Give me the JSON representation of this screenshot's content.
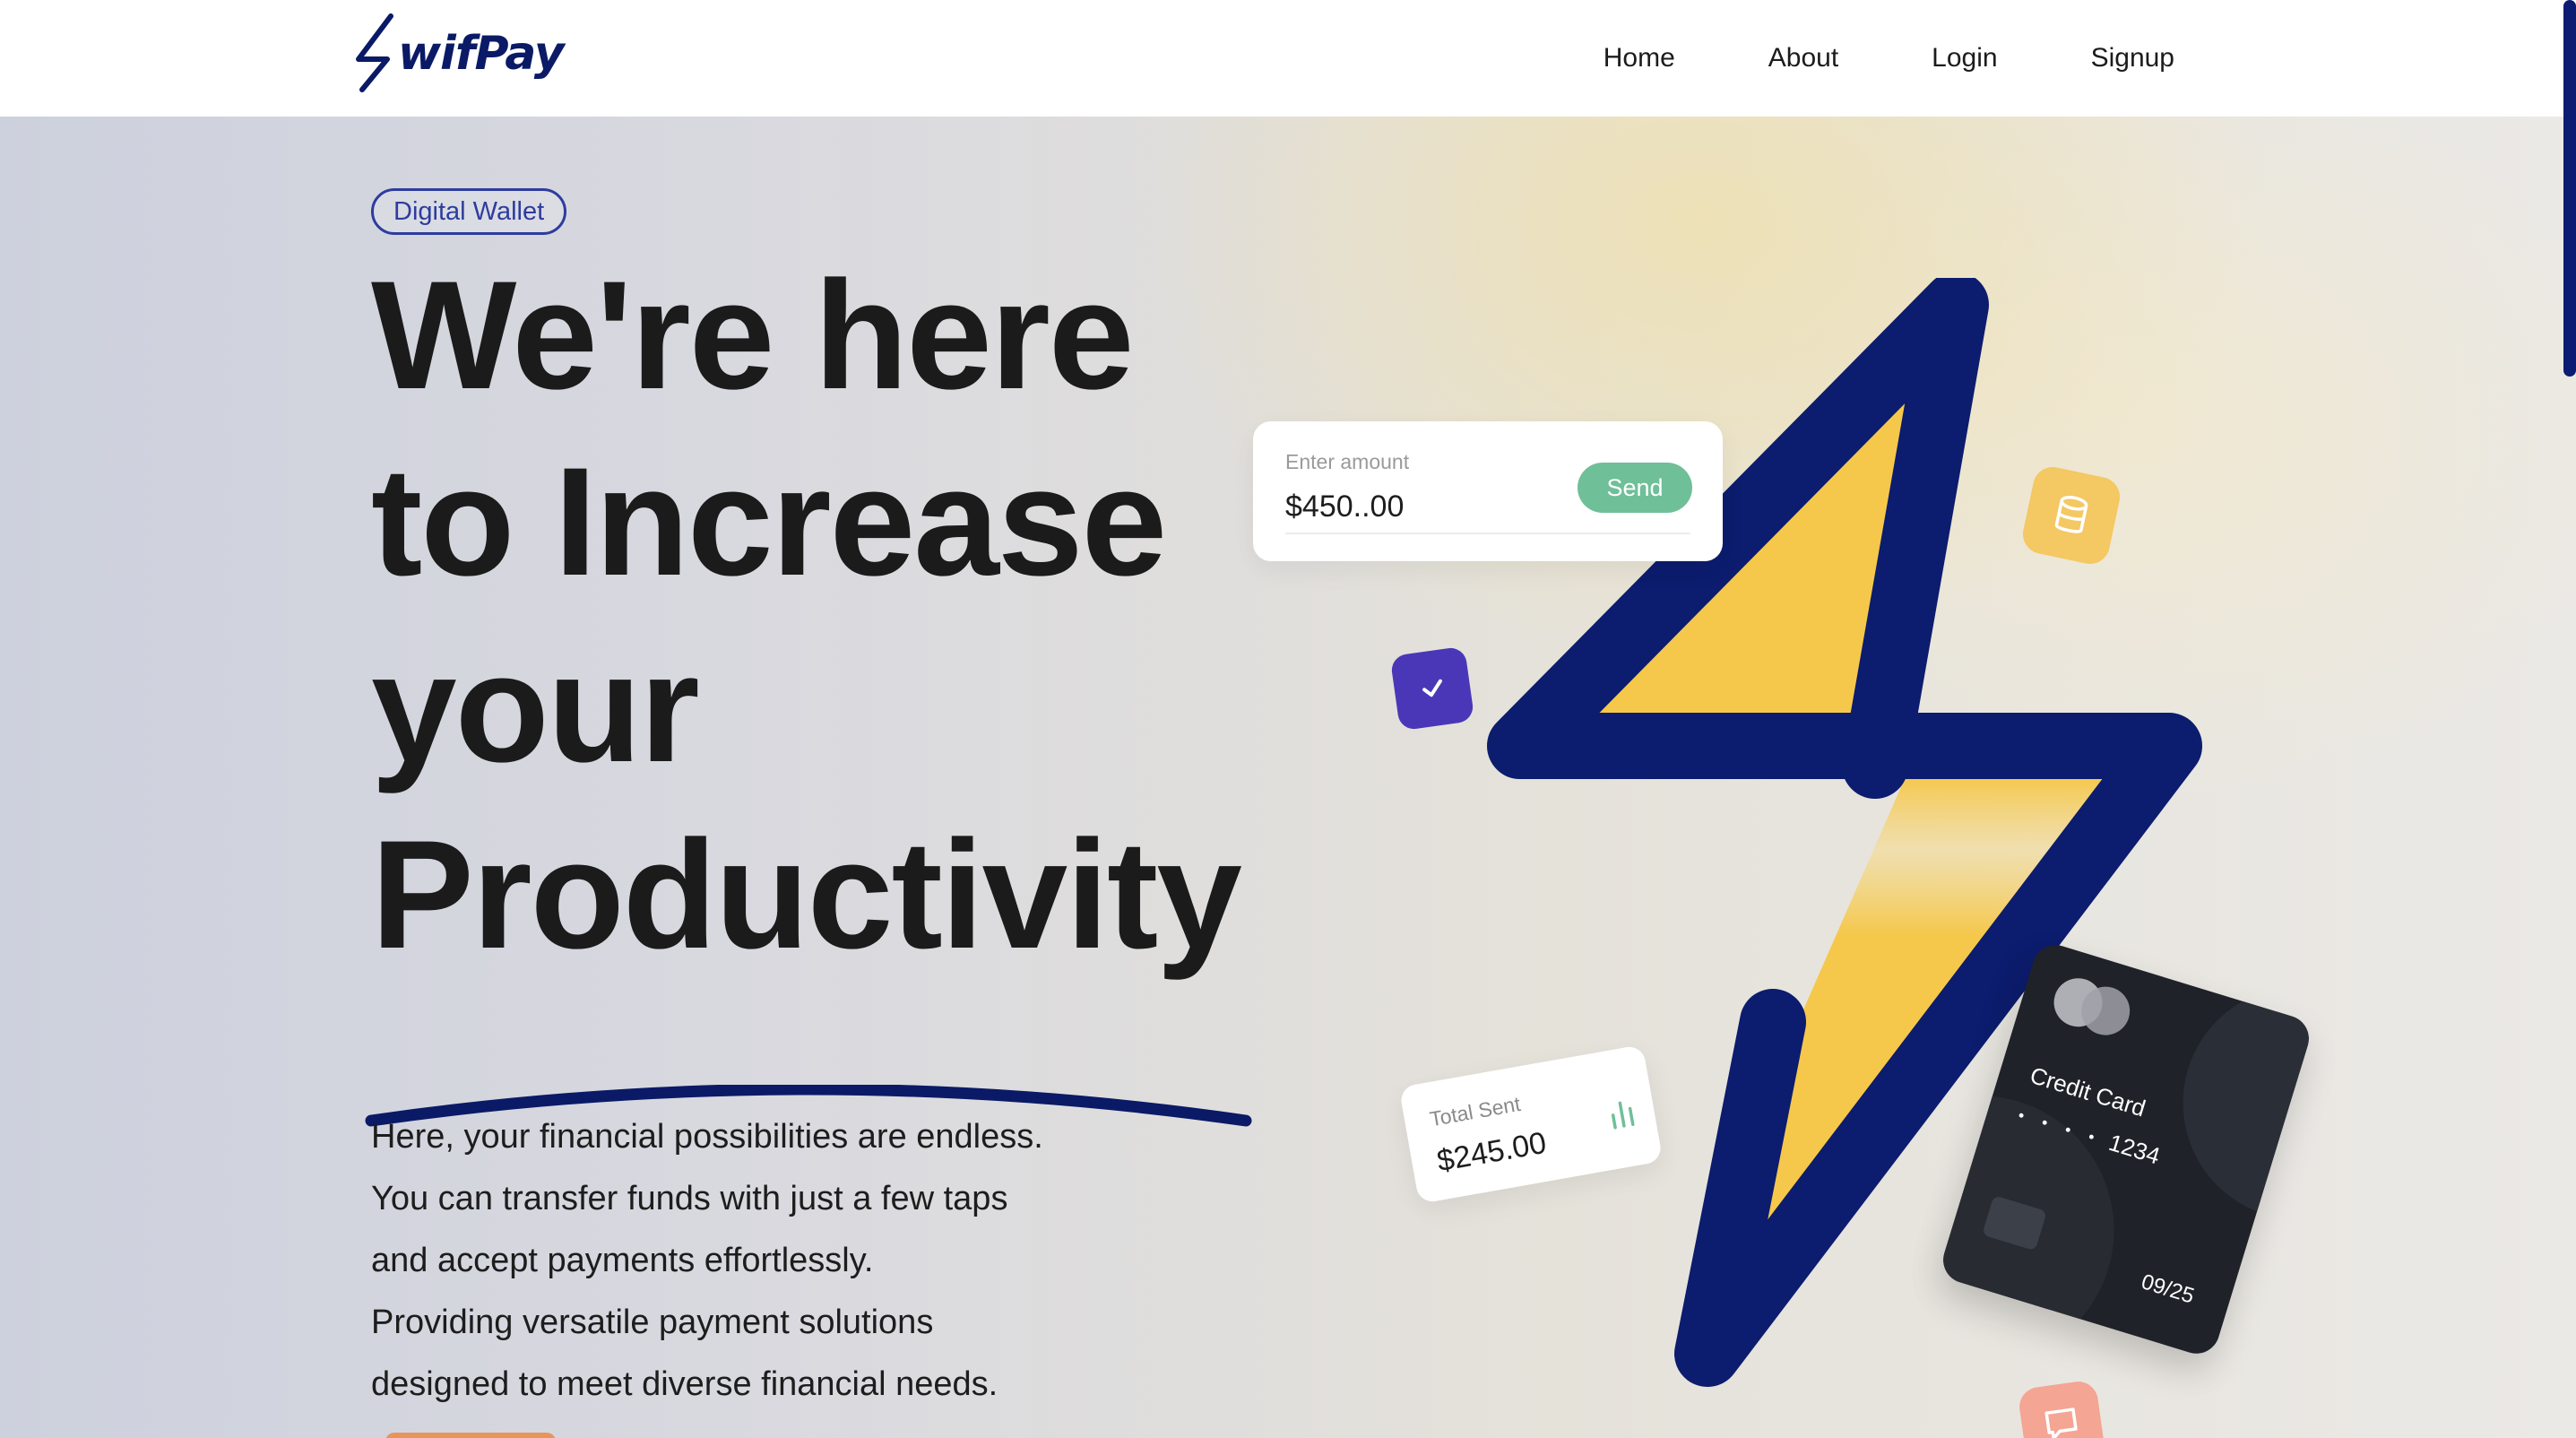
{
  "header": {
    "brand": "wifPay",
    "nav": {
      "home": "Home",
      "about": "About",
      "login": "Login",
      "signup": "Signup"
    }
  },
  "hero": {
    "badge": "Digital Wallet",
    "headline": [
      "We're here",
      "to Increase",
      "your",
      "Productivity"
    ],
    "description": [
      "Here, your financial possibilities are endless.",
      "You can transfer funds with just a few taps",
      "and accept payments effortlessly.",
      "Providing versatile payment solutions",
      "designed to meet diverse financial needs."
    ]
  },
  "amount_card": {
    "label": "Enter amount",
    "value": "$450..00",
    "button": "Send"
  },
  "sent_card": {
    "label": "Total Sent",
    "value": "$245.00"
  },
  "credit_card": {
    "label": "Credit Card",
    "masked": "• • • •",
    "last4": "1234",
    "expiry": "09/25"
  },
  "icons": {
    "check_tile": "check-icon",
    "db_tile": "database-icon",
    "chat_tile": "chat-icon",
    "chart": "bar-chart-icon"
  },
  "colors": {
    "brand_navy": "#0b1a66",
    "bolt_yellow": "#f5c84c",
    "send_green": "#6fbf98",
    "check_purple": "#4a37b8",
    "db_yellow": "#f4c862",
    "chat_salmon": "#f4a594",
    "cta_orange": "#e8955a"
  }
}
